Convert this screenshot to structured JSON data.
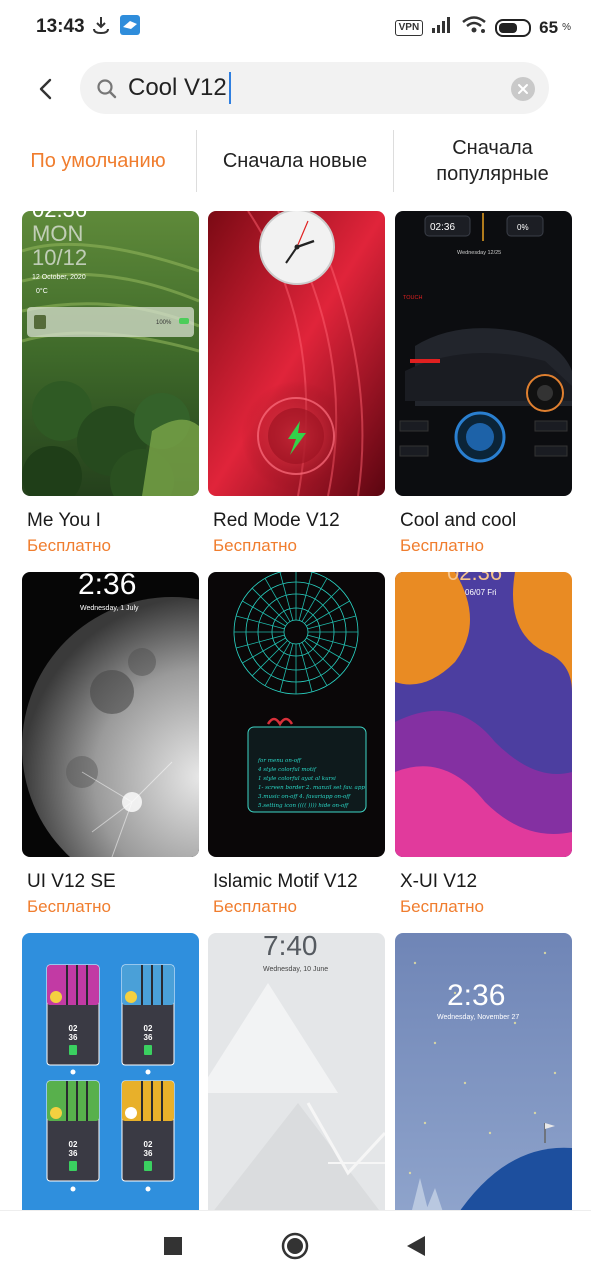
{
  "status_bar": {
    "time": "13:43",
    "vpn": "VPN",
    "battery": "65",
    "battery_unit": "%"
  },
  "search": {
    "value": "Cool V12"
  },
  "sort_tabs": [
    {
      "label": "По умолчанию",
      "active": true
    },
    {
      "label": "Сначала новые",
      "active": false
    },
    {
      "label": "Сначала популярные",
      "active": false
    }
  ],
  "themes": [
    {
      "title": "Me You I",
      "price": "Бесплатно",
      "preview": {
        "time": "02:36",
        "day": "MON",
        "date": "10/12",
        "subdate": "12 October, 2020",
        "temp": "0°C",
        "battery": "100%"
      }
    },
    {
      "title": "Red Mode V12",
      "price": "Бесплатно",
      "preview": {}
    },
    {
      "title": "Cool and cool",
      "price": "Бесплатно",
      "preview": {
        "time": "02:36",
        "pct": "0%",
        "date": "Wednesday 12/25",
        "touch": "TOUCH"
      }
    },
    {
      "title": "UI V12 SE",
      "price": "Бесплатно",
      "preview": {
        "time": "2:36",
        "date": "Wednesday, 1 July"
      }
    },
    {
      "title": "Islamic Motif V12",
      "price": "Бесплатно",
      "preview": {
        "lines": [
          "for menu on-off",
          "4 style colorful motif",
          "1 style colorful ayat al kursi",
          "1- screen border 2. manzil set fav. app",
          "3.music on-off 4. favariapp on-off",
          "5.setting icon (((( )))) hide on-off"
        ]
      }
    },
    {
      "title": "X-UI V12",
      "price": "Бесплатно",
      "preview": {
        "time": "02:36",
        "date": "06/07 Fri"
      }
    },
    {
      "title": "",
      "price": "",
      "preview": {
        "time_a": "02",
        "time_b": "36"
      }
    },
    {
      "title": "",
      "price": "",
      "preview": {
        "time": "7:40",
        "date": "Wednesday, 10 June"
      }
    },
    {
      "title": "",
      "price": "",
      "preview": {
        "time": "2:36",
        "date": "Wednesday, November 27"
      }
    }
  ],
  "colors": {
    "accent": "#f07d2e",
    "search_bg": "#f2f2f2"
  }
}
